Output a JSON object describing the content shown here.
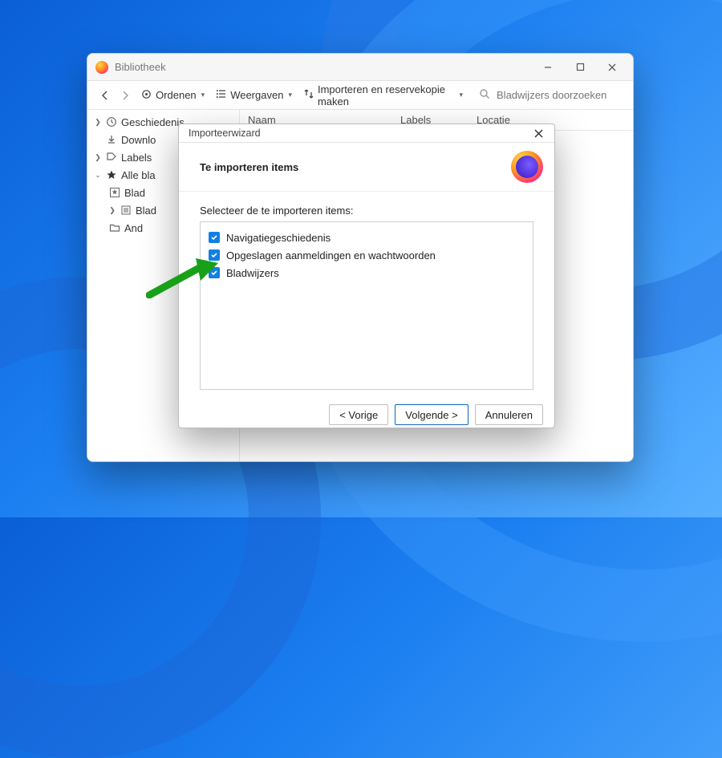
{
  "library": {
    "title": "Bibliotheek",
    "toolbar": {
      "order": "Ordenen",
      "views": "Weergaven",
      "import": "Importeren en reservekopie maken",
      "search_placeholder": "Bladwijzers doorzoeken"
    },
    "columns": {
      "name": "Naam",
      "labels": "Labels",
      "location": "Locatie"
    },
    "tree": {
      "history": "Geschiedenis",
      "downloads": "Downlo",
      "labels": "Labels",
      "all_bookmarks": "Alle bla",
      "child1": "Blad",
      "child2": "Blad",
      "child3": "And"
    }
  },
  "wizard": {
    "title": "Importeerwizard",
    "heading": "Te importeren items",
    "prompt": "Selecteer de te importeren items:",
    "items": [
      "Navigatiegeschiedenis",
      "Opgeslagen aanmeldingen en wachtwoorden",
      "Bladwijzers"
    ],
    "buttons": {
      "back": "< Vorige",
      "next": "Volgende >",
      "cancel": "Annuleren"
    }
  }
}
